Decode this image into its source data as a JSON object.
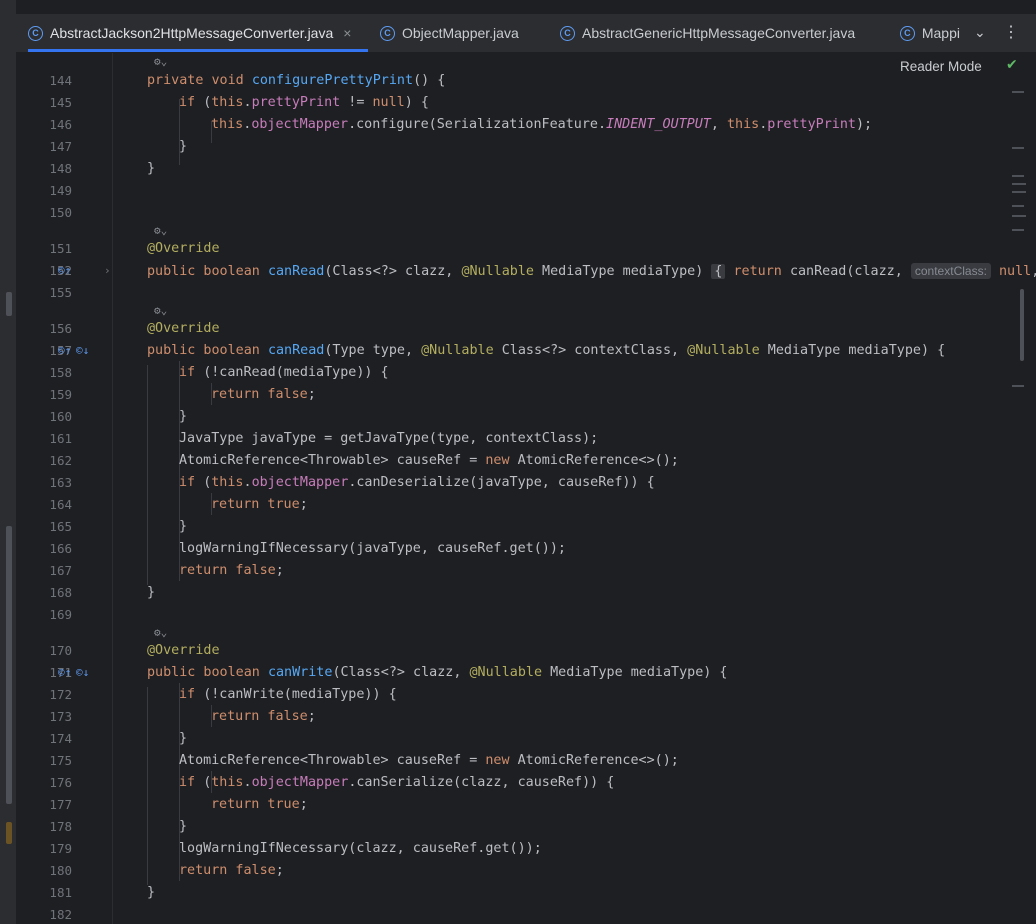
{
  "tabs": [
    {
      "label": "AbstractJackson2HttpMessageConverter.java",
      "active": true,
      "close": "×",
      "icon": "java-class-icon"
    },
    {
      "label": "ObjectMapper.java",
      "active": false,
      "icon": "java-class-icon"
    },
    {
      "label": "AbstractGenericHttpMessageConverter.java",
      "active": false,
      "icon": "java-class-icon"
    },
    {
      "label": "Mappi",
      "active": false,
      "icon": "java-class-icon"
    }
  ],
  "tab_icon_glyph": "C",
  "tabs_dropdown": "⌄",
  "tabs_more": "⋮",
  "reader_mode": "Reader Mode",
  "inspection_glyph": "✔",
  "fold_glyph": "›",
  "author_hint": "⚙⌄",
  "gutter_icons": {
    "override_up": "©↑",
    "implemented_down": "©↓"
  },
  "code_lines": [
    {
      "n": "144",
      "t": "private void configurePrettyPrint() {"
    },
    {
      "n": "145",
      "t": "if (this.prettyPrint != null) {"
    },
    {
      "n": "146",
      "t": "this.objectMapper.configure(SerializationFeature.INDENT_OUTPUT, this.prettyPrint);"
    },
    {
      "n": "147",
      "t": "}"
    },
    {
      "n": "148",
      "t": "}"
    },
    {
      "n": "149",
      "t": ""
    },
    {
      "n": "150",
      "t": ""
    },
    {
      "n": "151",
      "t": "@Override"
    },
    {
      "n": "152",
      "t": "public boolean canRead(Class<?> clazz, @Nullable MediaType mediaType) { return canRead(clazz, contextClass: null,"
    },
    {
      "n": "155",
      "t": ""
    },
    {
      "n": "156",
      "t": "@Override"
    },
    {
      "n": "157",
      "t": "public boolean canRead(Type type, @Nullable Class<?> contextClass, @Nullable MediaType mediaType) {"
    },
    {
      "n": "158",
      "t": "if (!canRead(mediaType)) {"
    },
    {
      "n": "159",
      "t": "return false;"
    },
    {
      "n": "160",
      "t": "}"
    },
    {
      "n": "161",
      "t": "JavaType javaType = getJavaType(type, contextClass);"
    },
    {
      "n": "162",
      "t": "AtomicReference<Throwable> causeRef = new AtomicReference<>();"
    },
    {
      "n": "163",
      "t": "if (this.objectMapper.canDeserialize(javaType, causeRef)) {"
    },
    {
      "n": "164",
      "t": "return true;"
    },
    {
      "n": "165",
      "t": "}"
    },
    {
      "n": "166",
      "t": "logWarningIfNecessary(javaType, causeRef.get());"
    },
    {
      "n": "167",
      "t": "return false;"
    },
    {
      "n": "168",
      "t": "}"
    },
    {
      "n": "169",
      "t": ""
    },
    {
      "n": "170",
      "t": "@Override"
    },
    {
      "n": "171",
      "t": "public boolean canWrite(Class<?> clazz, @Nullable MediaType mediaType) {"
    },
    {
      "n": "172",
      "t": "if (!canWrite(mediaType)) {"
    },
    {
      "n": "173",
      "t": "return false;"
    },
    {
      "n": "174",
      "t": "}"
    },
    {
      "n": "175",
      "t": "AtomicReference<Throwable> causeRef = new AtomicReference<>();"
    },
    {
      "n": "176",
      "t": "if (this.objectMapper.canSerialize(clazz, causeRef)) {"
    },
    {
      "n": "177",
      "t": "return true;"
    },
    {
      "n": "178",
      "t": "}"
    },
    {
      "n": "179",
      "t": "logWarningIfNecessary(clazz, causeRef.get());"
    },
    {
      "n": "180",
      "t": "return false;"
    },
    {
      "n": "181",
      "t": "}"
    },
    {
      "n": "182",
      "t": ""
    }
  ],
  "colors": {
    "background": "#1e1f22",
    "keyword": "#cf8e6d",
    "method": "#56a8f5",
    "annotation": "#b3ae60",
    "field": "#c77dbb",
    "text": "#bcbec4",
    "line_number": "#6f737a",
    "tab_accent": "#3574f0",
    "ok_check": "#5fb865"
  }
}
